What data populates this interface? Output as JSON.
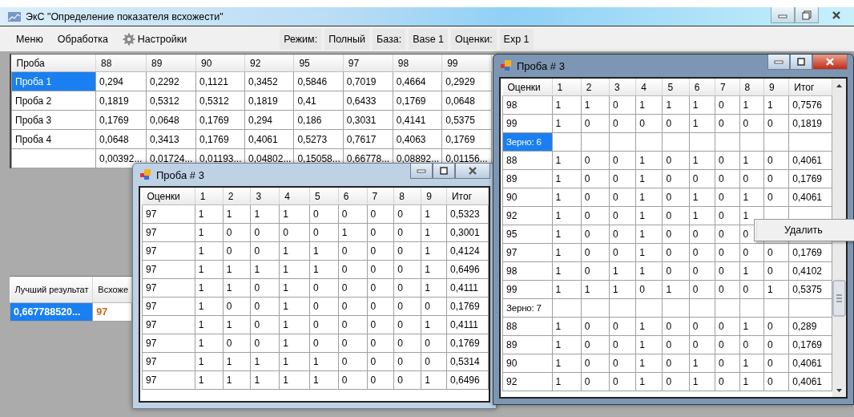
{
  "window": {
    "title": "ЭкС \"Определение показателя всхожести\""
  },
  "menu": [
    {
      "label": "Меню",
      "kind": "text"
    },
    {
      "label": "Обработка",
      "kind": "text"
    },
    {
      "label": "Настройки",
      "kind": "gear"
    }
  ],
  "status": [
    {
      "label": "Режим:",
      "value": "Полный"
    },
    {
      "label": "База:",
      "value": "Base 1"
    },
    {
      "label": "Оценки:",
      "value": "Exp 1"
    }
  ],
  "main_table": {
    "columns": [
      "Проба",
      "88",
      "89",
      "90",
      "92",
      "95",
      "97",
      "98",
      "99"
    ],
    "rows": [
      {
        "selected": true,
        "cells": [
          "Проба 1",
          "0,294",
          "0,2292",
          "0,1121",
          "0,3452",
          "0,5846",
          "0,7019",
          "0,4664",
          "0,2929"
        ]
      },
      {
        "selected": false,
        "cells": [
          "Проба 2",
          "0,1819",
          "0,5312",
          "0,5312",
          "0,1819",
          "0,41",
          "0,6433",
          "0,1769",
          "0,0648"
        ]
      },
      {
        "selected": false,
        "cells": [
          "Проба 3",
          "0,1769",
          "0,0648",
          "0,1769",
          "0,294",
          "0,186",
          "0,3031",
          "0,4141",
          "0,5375"
        ]
      },
      {
        "selected": false,
        "cells": [
          "Проба 4",
          "0,0648",
          "0,3413",
          "0,1769",
          "0,4061",
          "0,5273",
          "0,7617",
          "0,4063",
          "0,1769"
        ]
      },
      {
        "selected": false,
        "cells": [
          "",
          "0,00392...",
          "0,01724...",
          "0,01193...",
          "0,04802...",
          "0,15058...",
          "0,66778...",
          "0,08892...",
          "0,01156..."
        ]
      }
    ]
  },
  "best_table": {
    "columns": [
      "Лучший результат",
      "Всхоже"
    ],
    "rows": [
      {
        "selected": true,
        "cells": [
          "0,667788520...",
          "97"
        ]
      }
    ]
  },
  "child_windows": [
    {
      "title": "Проба # 3",
      "active": false,
      "scrollbar": false,
      "columns": [
        "Оценки",
        "1",
        "2",
        "3",
        "4",
        "5",
        "6",
        "7",
        "8",
        "9",
        "Итог"
      ],
      "rows": [
        {
          "kind": "data",
          "selected": false,
          "cells": [
            "97",
            "1",
            "1",
            "1",
            "1",
            "0",
            "0",
            "0",
            "0",
            "1",
            "0,5323"
          ]
        },
        {
          "kind": "data",
          "selected": false,
          "cells": [
            "97",
            "1",
            "0",
            "0",
            "0",
            "0",
            "1",
            "0",
            "0",
            "1",
            "0,3001"
          ]
        },
        {
          "kind": "data",
          "selected": false,
          "cells": [
            "97",
            "1",
            "0",
            "0",
            "1",
            "1",
            "0",
            "0",
            "0",
            "1",
            "0,4124"
          ]
        },
        {
          "kind": "data",
          "selected": false,
          "cells": [
            "97",
            "1",
            "1",
            "1",
            "1",
            "1",
            "0",
            "0",
            "0",
            "1",
            "0,6496"
          ]
        },
        {
          "kind": "data",
          "selected": false,
          "cells": [
            "97",
            "1",
            "1",
            "0",
            "1",
            "0",
            "0",
            "0",
            "0",
            "1",
            "0,4111"
          ]
        },
        {
          "kind": "data",
          "selected": false,
          "cells": [
            "97",
            "1",
            "0",
            "0",
            "1",
            "0",
            "0",
            "0",
            "0",
            "0",
            "0,1769"
          ]
        },
        {
          "kind": "data",
          "selected": false,
          "cells": [
            "97",
            "1",
            "1",
            "0",
            "1",
            "0",
            "0",
            "0",
            "0",
            "1",
            "0,4111"
          ]
        },
        {
          "kind": "data",
          "selected": false,
          "cells": [
            "97",
            "1",
            "0",
            "0",
            "1",
            "0",
            "0",
            "0",
            "0",
            "0",
            "0,1769"
          ]
        },
        {
          "kind": "data",
          "selected": false,
          "cells": [
            "97",
            "1",
            "1",
            "1",
            "1",
            "1",
            "0",
            "0",
            "0",
            "0",
            "0,5314"
          ]
        },
        {
          "kind": "data",
          "selected": false,
          "cells": [
            "97",
            "1",
            "1",
            "1",
            "1",
            "1",
            "0",
            "0",
            "0",
            "1",
            "0,6496"
          ]
        }
      ]
    },
    {
      "title": "Проба # 3",
      "active": true,
      "scrollbar": true,
      "columns": [
        "Оценки",
        "1",
        "2",
        "3",
        "4",
        "5",
        "6",
        "7",
        "8",
        "9",
        "Итог"
      ],
      "rows": [
        {
          "kind": "data",
          "selected": false,
          "cells": [
            "98",
            "1",
            "1",
            "0",
            "1",
            "1",
            "1",
            "0",
            "1",
            "1",
            "0,7576"
          ]
        },
        {
          "kind": "data",
          "selected": false,
          "cells": [
            "99",
            "1",
            "0",
            "0",
            "0",
            "0",
            "1",
            "0",
            "0",
            "0",
            "0,1819"
          ]
        },
        {
          "kind": "group",
          "selected": true,
          "cells": [
            "Зерно: 6"
          ]
        },
        {
          "kind": "data",
          "selected": false,
          "cells": [
            "88",
            "1",
            "0",
            "0",
            "1",
            "0",
            "1",
            "0",
            "1",
            "0",
            "0,4061"
          ]
        },
        {
          "kind": "data",
          "selected": false,
          "cells": [
            "89",
            "1",
            "0",
            "0",
            "1",
            "0",
            "0",
            "0",
            "0",
            "0",
            "0,1769"
          ]
        },
        {
          "kind": "data",
          "selected": false,
          "cells": [
            "90",
            "1",
            "0",
            "0",
            "1",
            "0",
            "1",
            "0",
            "1",
            "0",
            "0,4061"
          ]
        },
        {
          "kind": "data",
          "selected": false,
          "cells": [
            "92",
            "1",
            "0",
            "0",
            "1",
            "0",
            "1",
            "0",
            "1"
          ]
        },
        {
          "kind": "data",
          "selected": false,
          "cells": [
            "95",
            "1",
            "0",
            "0",
            "1",
            "0",
            "0",
            "0",
            "0"
          ]
        },
        {
          "kind": "data",
          "selected": false,
          "cells": [
            "97",
            "1",
            "0",
            "0",
            "1",
            "0",
            "0",
            "0",
            "0",
            "0",
            "0,1769"
          ]
        },
        {
          "kind": "data",
          "selected": false,
          "cells": [
            "98",
            "1",
            "0",
            "1",
            "1",
            "0",
            "0",
            "0",
            "1",
            "0",
            "0,4102"
          ]
        },
        {
          "kind": "data",
          "selected": false,
          "cells": [
            "99",
            "1",
            "1",
            "1",
            "0",
            "1",
            "0",
            "0",
            "0",
            "1",
            "0,5375"
          ]
        },
        {
          "kind": "group",
          "selected": false,
          "cells": [
            "Зерно: 7"
          ]
        },
        {
          "kind": "data",
          "selected": false,
          "cells": [
            "88",
            "1",
            "0",
            "0",
            "1",
            "0",
            "0",
            "0",
            "1",
            "0",
            "0,289"
          ]
        },
        {
          "kind": "data",
          "selected": false,
          "cells": [
            "89",
            "1",
            "0",
            "0",
            "1",
            "0",
            "0",
            "0",
            "0",
            "0",
            "0,1769"
          ]
        },
        {
          "kind": "data",
          "selected": false,
          "cells": [
            "90",
            "1",
            "0",
            "0",
            "1",
            "0",
            "1",
            "0",
            "1",
            "0",
            "0,4061"
          ]
        },
        {
          "kind": "data",
          "selected": false,
          "cells": [
            "92",
            "1",
            "0",
            "0",
            "1",
            "0",
            "1",
            "0",
            "1",
            "0",
            "0,4061"
          ]
        }
      ]
    }
  ],
  "context_menu": {
    "items": [
      "Удалить"
    ]
  }
}
